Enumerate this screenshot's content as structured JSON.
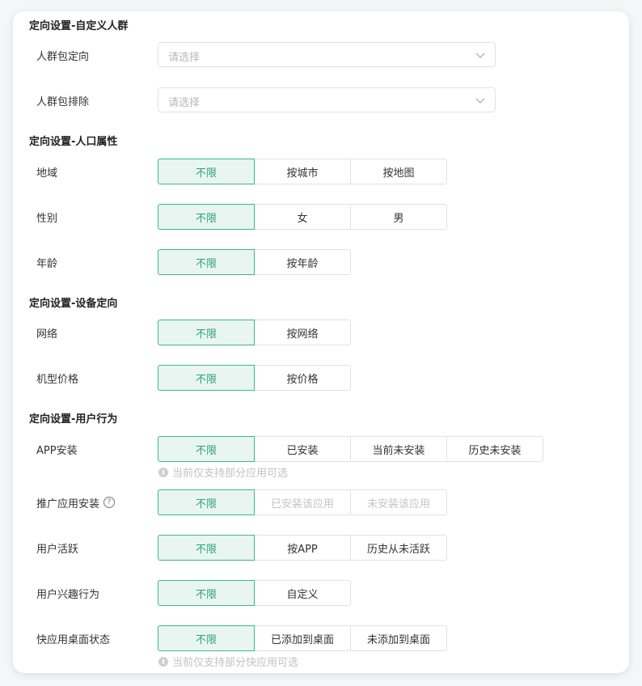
{
  "sections": {
    "custom_crowd": "定向设置-自定义人群",
    "demographics": "定向设置-人口属性",
    "device": "定向设置-设备定向",
    "behavior": "定向设置-用户行为"
  },
  "crowd_include": {
    "label": "人群包定向",
    "placeholder": "请选择"
  },
  "crowd_exclude": {
    "label": "人群包排除",
    "placeholder": "请选择"
  },
  "region": {
    "label": "地域",
    "options": [
      "不限",
      "按城市",
      "按地图"
    ],
    "selected": "不限"
  },
  "gender": {
    "label": "性别",
    "options": [
      "不限",
      "女",
      "男"
    ],
    "selected": "不限"
  },
  "age": {
    "label": "年龄",
    "options": [
      "不限",
      "按年龄"
    ],
    "selected": "不限"
  },
  "network": {
    "label": "网络",
    "options": [
      "不限",
      "按网络"
    ],
    "selected": "不限"
  },
  "device_price": {
    "label": "机型价格",
    "options": [
      "不限",
      "按价格"
    ],
    "selected": "不限"
  },
  "app_install": {
    "label": "APP安装",
    "options": [
      "不限",
      "已安装",
      "当前未安装",
      "历史未安装"
    ],
    "selected": "不限",
    "hint": "当前仅支持部分应用可选"
  },
  "promoted_app_install": {
    "label": "推广应用安装",
    "help_icon": "?",
    "options": [
      "不限",
      "已安装该应用",
      "未安装该应用"
    ],
    "disabled_options": [
      "已安装该应用",
      "未安装该应用"
    ],
    "selected": "不限"
  },
  "user_active": {
    "label": "用户活跃",
    "options": [
      "不限",
      "按APP",
      "历史从未活跃"
    ],
    "selected": "不限"
  },
  "user_interest": {
    "label": "用户兴趣行为",
    "options": [
      "不限",
      "自定义"
    ],
    "selected": "不限"
  },
  "quickapp_desktop": {
    "label": "快应用桌面状态",
    "options": [
      "不限",
      "已添加到桌面",
      "未添加到桌面"
    ],
    "selected": "不限",
    "hint": "当前仅支持部分快应用可选"
  },
  "colors": {
    "accent": "#3ab98f",
    "accent_bg": "#e8f5f0",
    "border": "#e2e2e2"
  }
}
